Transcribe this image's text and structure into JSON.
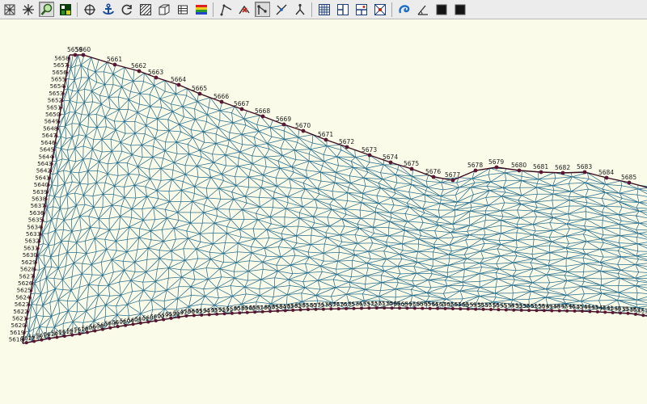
{
  "toolbar": {
    "groups": [
      [
        {
          "name": "refine-mesh-icon",
          "glyph": "grid-star"
        },
        {
          "name": "coarsen-mesh-icon",
          "glyph": "grid-burst"
        },
        {
          "name": "zoom-icon",
          "glyph": "magnifier",
          "active": true
        },
        {
          "name": "display-options-icon",
          "glyph": "palette"
        }
      ],
      [
        {
          "name": "add-node-icon",
          "glyph": "target"
        },
        {
          "name": "anchor-icon",
          "glyph": "anchor"
        },
        {
          "name": "refresh-icon",
          "glyph": "refresh"
        },
        {
          "name": "elements-icon",
          "glyph": "hatch-box"
        },
        {
          "name": "cube-icon",
          "glyph": "cube"
        },
        {
          "name": "table-icon",
          "glyph": "table"
        },
        {
          "name": "color-scale-icon",
          "glyph": "rainbow"
        }
      ],
      [
        {
          "name": "arc-icon",
          "glyph": "arc"
        },
        {
          "name": "delete-arc-icon",
          "glyph": "arc-x"
        },
        {
          "name": "select-arc-icon",
          "glyph": "arc-select",
          "active": true
        },
        {
          "name": "split-arc-icon",
          "glyph": "arc-split"
        },
        {
          "name": "merge-arc-icon",
          "glyph": "arc-merge"
        }
      ],
      [
        {
          "name": "grid-icon",
          "glyph": "grid"
        },
        {
          "name": "layout-icon",
          "glyph": "layout-a"
        },
        {
          "name": "layout-b-icon",
          "glyph": "layout-b"
        },
        {
          "name": "layout-c-icon",
          "glyph": "layout-c"
        }
      ],
      [
        {
          "name": "swirl-icon",
          "glyph": "swirl"
        },
        {
          "name": "angle-icon",
          "glyph": "angle"
        },
        {
          "name": "black-square-icon",
          "glyph": "black-square"
        },
        {
          "name": "black-square-2-icon",
          "glyph": "black-square"
        }
      ]
    ]
  },
  "mesh": {
    "colors": {
      "background": "#fbfbe9",
      "edge": "#2a6f8c",
      "boundary": "#3b0f22",
      "node": "#5a1733",
      "label": "#1a1a1a"
    },
    "top_boundary_labels": [
      "5659",
      "5660",
      "5661",
      "5662",
      "5663",
      "5664",
      "5665",
      "5666",
      "5667",
      "5668",
      "5669",
      "5670",
      "5671",
      "5672",
      "5673",
      "5674",
      "5675",
      "5676",
      "5677",
      "5678",
      "5679",
      "5680",
      "5681",
      "5682",
      "5683",
      "5684",
      "5685"
    ],
    "left_boundary_labels": [
      "5618",
      "5619",
      "5620",
      "5621",
      "5622",
      "5623",
      "5624",
      "5625",
      "5626",
      "5627",
      "5628",
      "5629",
      "5630",
      "5631",
      "5632",
      "5633",
      "5634",
      "5635",
      "5636",
      "5637",
      "5638",
      "5639",
      "5640",
      "5641",
      "5642",
      "5643",
      "5644",
      "5645",
      "5646",
      "5647",
      "5648",
      "5649",
      "5650",
      "5651",
      "5652",
      "5653",
      "5654",
      "5655",
      "5656",
      "5657",
      "5658"
    ],
    "bottom_boundary_labels": [
      "5617",
      "5616",
      "5615",
      "5614",
      "5613",
      "5612",
      "5611",
      "5610",
      "5609",
      "5608",
      "5607",
      "5606",
      "5605",
      "5604",
      "5603",
      "5602",
      "5601",
      "5600",
      "5599",
      "5598",
      "5597",
      "5596",
      "5595",
      "5594",
      "5593",
      "5592",
      "5591",
      "5590",
      "5589",
      "5588",
      "5587",
      "5586",
      "5585",
      "5584",
      "5583",
      "5582",
      "5581",
      "5580",
      "5579",
      "5578",
      "5577",
      "5576",
      "5575",
      "5574",
      "5573",
      "5572",
      "5571",
      "5570",
      "5569",
      "5568",
      "5567",
      "5566",
      "5565",
      "5564",
      "5563",
      "5562",
      "5561",
      "5560",
      "5559",
      "5558",
      "5557",
      "5556",
      "5555",
      "5554",
      "5553",
      "5552",
      "5551",
      "5550",
      "5549",
      "5548",
      "5547",
      "5546",
      "5545",
      "5544",
      "5543",
      "5542",
      "5541",
      "5540",
      "5539",
      "5538",
      "5537",
      "5536"
    ]
  }
}
